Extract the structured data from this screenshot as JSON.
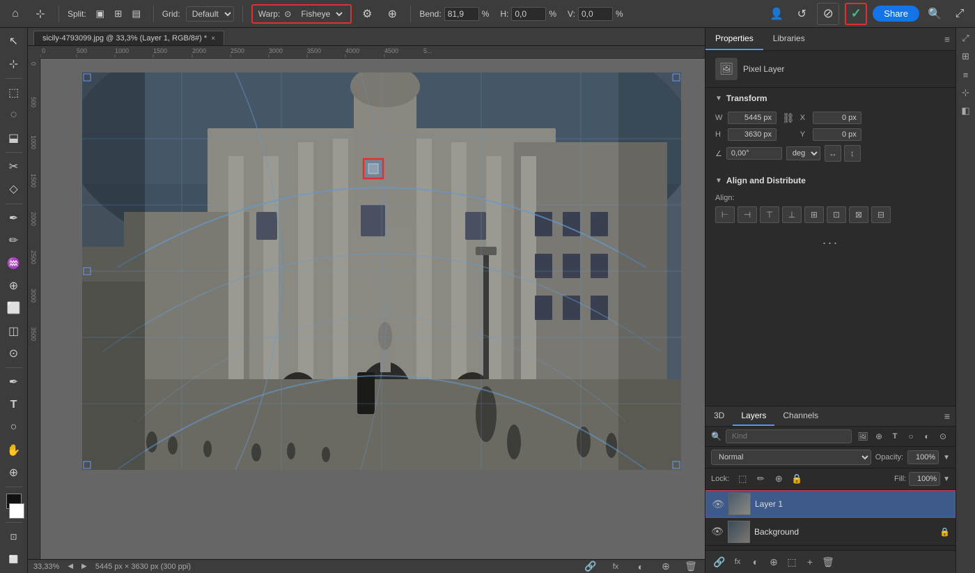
{
  "toolbar": {
    "home_icon": "⌂",
    "select_icon": "⊹",
    "split_label": "Split:",
    "split_icons": [
      "▣",
      "⊞",
      "▤"
    ],
    "grid_label": "Grid:",
    "grid_default": "Default",
    "warp_label": "Warp:",
    "warp_icon": "⊙",
    "warp_value": "Fisheye",
    "settings_icon": "⚙",
    "puppet_icon": "⊕",
    "bend_label": "Bend:",
    "bend_value": "81,9",
    "bend_unit": "%",
    "h_label": "H:",
    "h_value": "0,0",
    "h_unit": "%",
    "v_label": "V:",
    "v_value": "0,0",
    "v_unit": "%",
    "cancel_icon": "✕",
    "confirm_icon": "✓",
    "share_label": "Share",
    "search_icon": "🔍",
    "expand_icon": "⤢"
  },
  "tab": {
    "title": "sicily-4793099.jpg @ 33,3% (Layer 1, RGB/8#) *",
    "close_icon": "×"
  },
  "status_bar": {
    "zoom": "33,33%",
    "resolution": "5445 px × 3630 px (300 ppi)",
    "prev_icon": "◀",
    "next_icon": "▶",
    "link_icon": "🔗",
    "fx_icon": "fx",
    "mask_icon": "◐",
    "adjust_icon": "⊕",
    "delete_icon": "🗑"
  },
  "properties": {
    "tabs": [
      {
        "label": "Properties",
        "active": true
      },
      {
        "label": "Libraries",
        "active": false
      }
    ],
    "pixel_layer_label": "Pixel Layer",
    "transform": {
      "title": "Transform",
      "w_label": "W",
      "w_value": "5445 px",
      "x_label": "X",
      "x_value": "0 px",
      "h_label": "H",
      "h_value": "3630 px",
      "y_label": "Y",
      "y_value": "0 px",
      "angle_value": "0,00°",
      "flip_h_icon": "↔",
      "flip_v_icon": "↕"
    },
    "align": {
      "title": "Align and Distribute",
      "label": "Align:",
      "icons": [
        "⊢",
        "⊣",
        "⊤",
        "⊥",
        "⊞",
        "⊡",
        "⊠",
        "⊟"
      ]
    }
  },
  "layers": {
    "tabs": [
      {
        "label": "3D",
        "active": false
      },
      {
        "label": "Layers",
        "active": true
      },
      {
        "label": "Channels",
        "active": false
      }
    ],
    "search_placeholder": "Kind",
    "blend_mode": "Normal",
    "opacity_label": "Opacity:",
    "opacity_value": "100%",
    "lock_label": "Lock:",
    "fill_label": "Fill:",
    "fill_value": "100%",
    "items": [
      {
        "name": "Layer 1",
        "visible": true,
        "selected": true,
        "locked": false
      },
      {
        "name": "Background",
        "visible": true,
        "selected": false,
        "locked": true
      }
    ],
    "footer_icons": [
      "🔗",
      "fx",
      "◐",
      "⊕",
      "🗑"
    ]
  },
  "left_tools": [
    "V",
    "A",
    "⊹",
    "⬚",
    "⬓",
    "○",
    "P",
    "◇",
    "✏",
    "✒",
    "S",
    "E",
    "⦿",
    "G",
    "✋",
    "∥",
    "T",
    "◻",
    "⊡",
    "⌛"
  ],
  "colors": {
    "accent_blue": "#5599ff",
    "accent_red": "#e03030",
    "bg_dark": "#2b2b2b",
    "bg_mid": "#3c3c3c",
    "selected_layer": "#3d5a8a"
  }
}
